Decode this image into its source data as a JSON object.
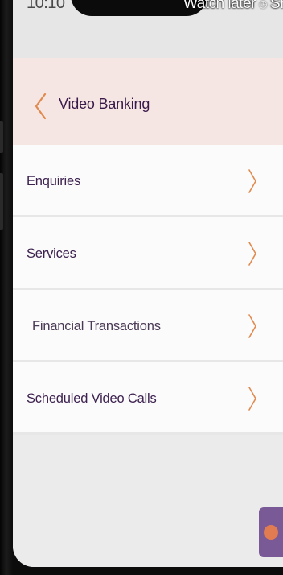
{
  "status_bar": {
    "time": "10:10",
    "overlay_text": "Watch later",
    "overlay_text_2": "Sh"
  },
  "header": {
    "title": "Video Banking",
    "back_icon": "chevron-left-icon"
  },
  "menu": {
    "items": [
      {
        "label": "Enquiries",
        "icon": "chevron-right-icon"
      },
      {
        "label": "Services",
        "icon": "chevron-right-icon"
      },
      {
        "label": "Financial Transactions",
        "icon": "chevron-right-icon"
      },
      {
        "label": "Scheduled Video Calls",
        "icon": "chevron-right-icon"
      }
    ]
  },
  "colors": {
    "accent": "#e08a4f",
    "header_bg": "#f6e6e3",
    "text_purple": "#3d2250"
  }
}
